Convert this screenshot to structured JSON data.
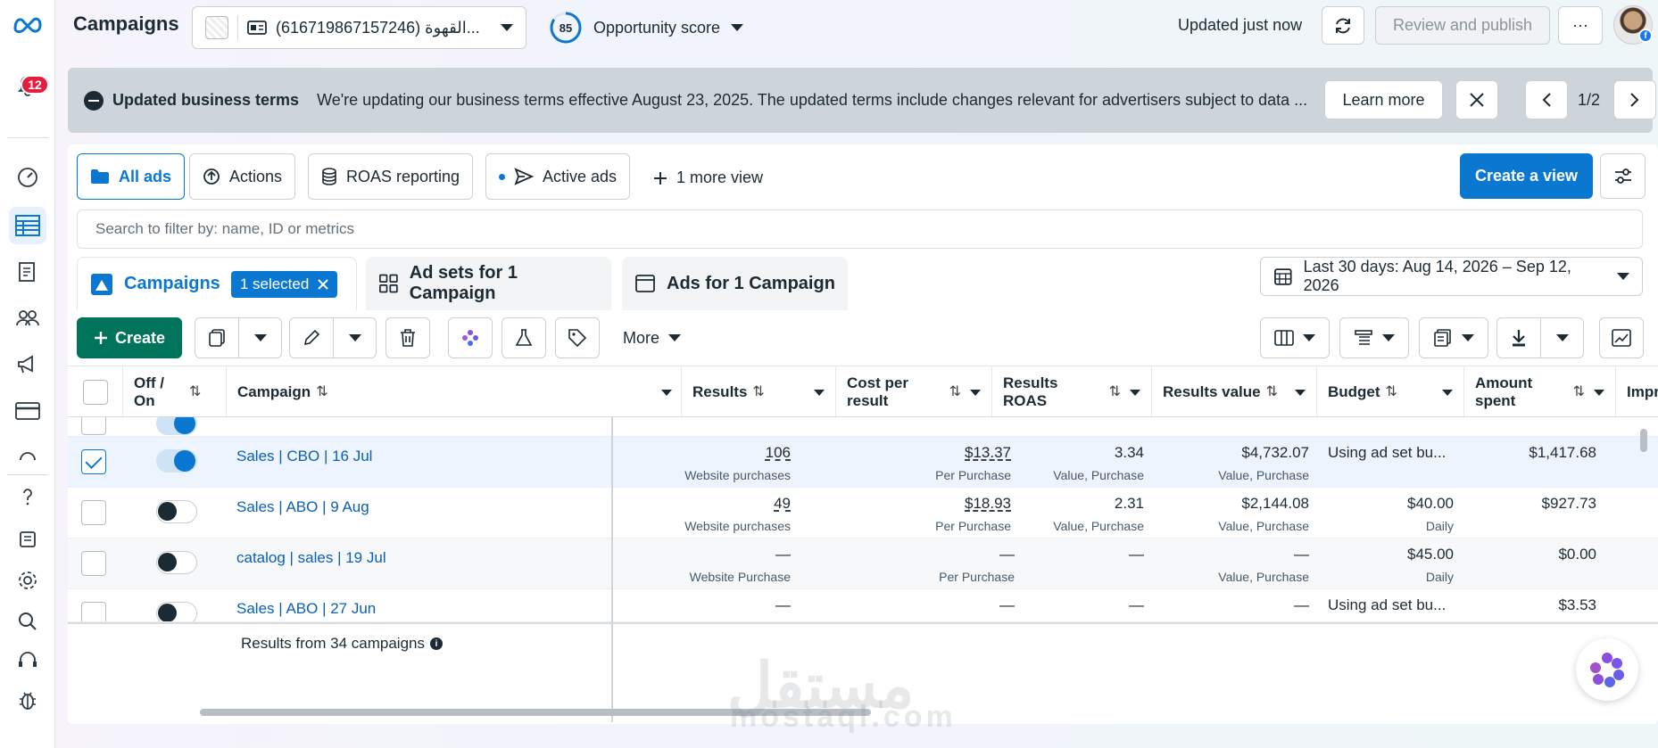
{
  "header": {
    "title": "Campaigns",
    "account": "(616719867157246) القهوة...",
    "opportunity_score": "85",
    "opportunity_label": "Opportunity score",
    "updated_text": "Updated just now",
    "review_publish": "Review and publish",
    "more": "···"
  },
  "rail": {
    "notification_count": "12"
  },
  "banner": {
    "title": "Updated business terms",
    "text": "We're updating our business terms effective August 23, 2025. The updated terms include changes relevant for advertisers subject to data ...",
    "learn_more": "Learn more",
    "pager": "1/2"
  },
  "views": {
    "tabs": [
      "All ads",
      "Actions",
      "ROAS reporting",
      "Active ads"
    ],
    "more_view": "1 more view",
    "create_view": "Create a view"
  },
  "search": {
    "placeholder": "Search to filter by: name, ID or metrics"
  },
  "levels": {
    "campaigns": "Campaigns",
    "selected_chip": "1 selected",
    "adsets": "Ad sets for 1 Campaign",
    "ads": "Ads for 1 Campaign",
    "date_range": "Last 30 days: Aug 14, 2026 – Sep 12, 2026"
  },
  "toolbar": {
    "create": "Create",
    "more": "More"
  },
  "table": {
    "columns": {
      "off_on": "Off / On",
      "campaign": "Campaign",
      "results": "Results",
      "cost_per_result": "Cost per result",
      "results_roas": "Results ROAS",
      "results_value": "Results value",
      "budget": "Budget",
      "amount_spent": "Amount spent",
      "impressions": "Impres"
    },
    "rows": [
      {
        "name": "Sales | CBO | 16 Jul",
        "checked": true,
        "on": true,
        "results": "106",
        "results_sub": "Website purchases",
        "cpr": "$13.37",
        "cpr_sub": "Per Purchase",
        "roas": "3.34",
        "roas_sub": "Value, Purchase",
        "value": "$4,732.07",
        "value_sub": "Value, Purchase",
        "budget": "Using ad set bu...",
        "budget_sub": "",
        "spent": "$1,417.68"
      },
      {
        "name": "Sales | ABO | 9 Aug",
        "checked": false,
        "on": false,
        "results": "49",
        "results_sub": "Website purchases",
        "cpr": "$18.93",
        "cpr_sub": "Per Purchase",
        "roas": "2.31",
        "roas_sub": "Value, Purchase",
        "value": "$2,144.08",
        "value_sub": "Value, Purchase",
        "budget": "$40.00",
        "budget_sub": "Daily",
        "spent": "$927.73"
      },
      {
        "name": "catalog | sales | 19 Jul",
        "checked": false,
        "on": false,
        "results": "—",
        "results_sub": "Website Purchase",
        "cpr": "—",
        "cpr_sub": "Per Purchase",
        "roas": "—",
        "roas_sub": "",
        "value": "—",
        "value_sub": "Value, Purchase",
        "budget": "$45.00",
        "budget_sub": "Daily",
        "spent": "$0.00"
      },
      {
        "name": "Sales | ABO | 27 Jun",
        "checked": false,
        "on": false,
        "results": "—",
        "results_sub": "",
        "cpr": "—",
        "cpr_sub": "",
        "roas": "—",
        "roas_sub": "",
        "value": "—",
        "value_sub": "",
        "budget": "Using ad set bu...",
        "budget_sub": "",
        "spent": "$3.53"
      }
    ],
    "summary": "Results from 34 campaigns"
  },
  "watermark": {
    "arabic": "مستقل",
    "latin": "mostaql.com"
  },
  "colors": {
    "accent": "#0a78d1",
    "create_green": "#00735b",
    "badge_red": "#e41e3f"
  }
}
